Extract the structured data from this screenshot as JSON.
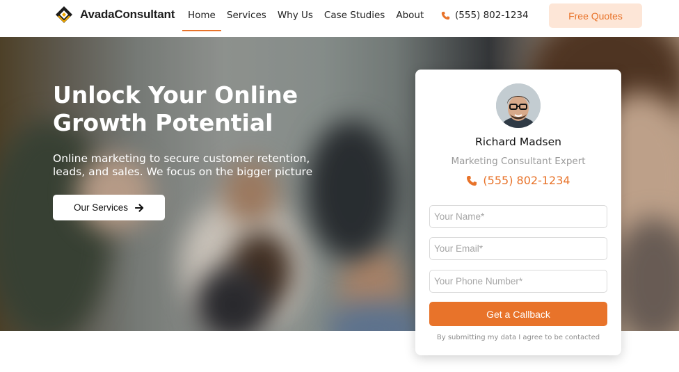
{
  "brand": {
    "name": "AvadaConsultant"
  },
  "nav": {
    "items": [
      {
        "label": "Home",
        "active": true
      },
      {
        "label": "Services",
        "active": false
      },
      {
        "label": "Why Us",
        "active": false
      },
      {
        "label": "Case Studies",
        "active": false
      },
      {
        "label": "About",
        "active": false
      }
    ],
    "phone": "(555) 802-1234",
    "cta": "Free Quotes"
  },
  "hero": {
    "title": "Unlock Your Online Growth Potential",
    "subtitle": "Online marketing to secure customer retention, leads, and sales. We focus on the bigger picture",
    "button": "Our Services",
    "button_icon": "arrow-right-icon"
  },
  "contact_card": {
    "name": "Richard Madsen",
    "role": "Marketing Consultant Expert",
    "phone": "(555) 802-1234",
    "fields": {
      "name_placeholder": "Your Name*",
      "email_placeholder": "Your Email*",
      "phone_placeholder": "Your Phone Number*"
    },
    "submit": "Get a Callback",
    "consent": "By submitting my data I agree to be contacted"
  },
  "colors": {
    "accent": "#e8732a",
    "accent_light": "#fde6d7"
  }
}
